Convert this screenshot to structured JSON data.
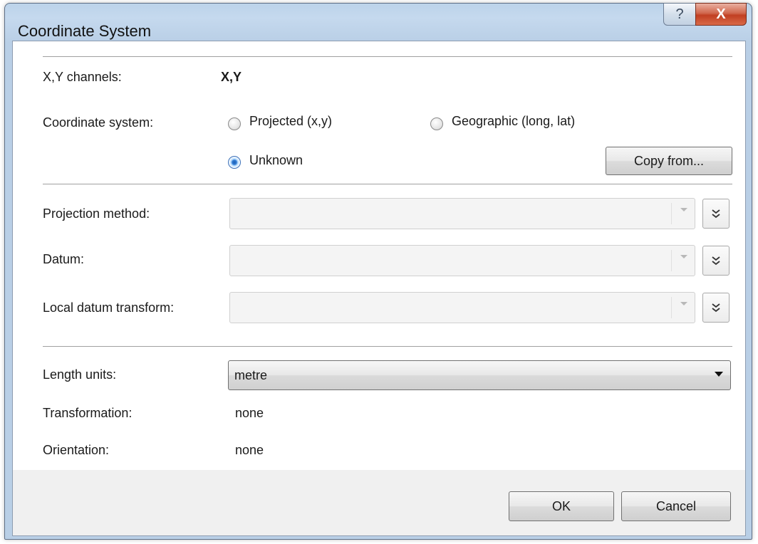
{
  "window": {
    "title": "Coordinate System",
    "help_label": "?",
    "close_label": "X"
  },
  "channels": {
    "label": "X,Y channels:",
    "value": "X,Y"
  },
  "coordinate_system": {
    "label": "Coordinate system:",
    "options": [
      {
        "label": "Projected (x,y)",
        "selected": false
      },
      {
        "label": "Geographic (long, lat)",
        "selected": false
      },
      {
        "label": "Unknown",
        "selected": true
      }
    ],
    "copy_from_label": "Copy from..."
  },
  "projection_method": {
    "label": "Projection method:",
    "value": ""
  },
  "datum": {
    "label": "Datum:",
    "value": ""
  },
  "local_datum_transform": {
    "label": "Local datum transform:",
    "value": ""
  },
  "length_units": {
    "label": "Length units:",
    "value": "metre"
  },
  "transformation": {
    "label": "Transformation:",
    "value": "none"
  },
  "orientation": {
    "label": "Orientation:",
    "value": "none"
  },
  "footer": {
    "ok_label": "OK",
    "cancel_label": "Cancel"
  },
  "icons": {
    "expand": "double-chevron-down-icon"
  }
}
